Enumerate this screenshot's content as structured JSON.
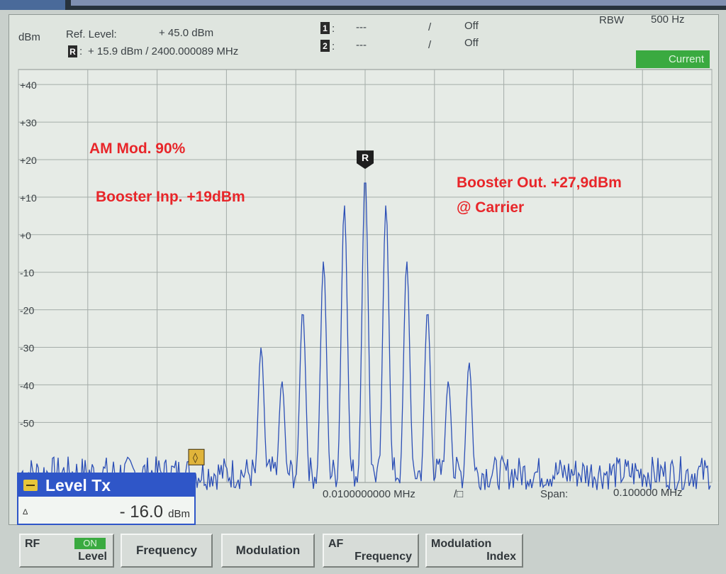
{
  "header": {
    "unit": "dBm",
    "ref_level_label": "Ref. Level:",
    "ref_level_value": "+ 45.0  dBm",
    "ref_marker_value": "+ 15.9  dBm /  2400.000089  MHz",
    "marker1_icon": "marker-1-icon",
    "marker1_value": "---",
    "marker1_sep": "/",
    "marker1_state": "Off",
    "marker2_icon": "marker-2-icon",
    "marker2_value": "---",
    "marker2_sep": "/",
    "marker2_state": "Off",
    "rbw_label": "RBW",
    "rbw_value": "500 Hz",
    "current_badge": "Current"
  },
  "footer": {
    "center_freq": "0.0100000000 MHz",
    "center_suffix": "/□",
    "span_label": "Span:",
    "span_value": "0.100000  MHz"
  },
  "annotations": {
    "am_mod": "AM Mod. 90%",
    "booster_inp": "Booster Inp. +19dBm",
    "booster_out_line1": "Booster Out. +27,9dBm",
    "booster_out_line2": "@ Carrier"
  },
  "level_box": {
    "title": "Level Tx",
    "delta": "Δ",
    "entry": "- 16.0",
    "unit": "dBm"
  },
  "softkeys": [
    {
      "name": "softkey-rf-level",
      "top_left": "RF",
      "badge": "ON",
      "bottom_right": "Level"
    },
    {
      "name": "softkey-frequency",
      "center": "Frequency"
    },
    {
      "name": "softkey-modulation",
      "center": "Modulation"
    },
    {
      "name": "softkey-af-frequency",
      "top_left": "AF",
      "bottom_right": "Frequency"
    },
    {
      "name": "softkey-modulation-index",
      "top_left": "Modulation",
      "bottom_right": "Index"
    }
  ],
  "chart_data": {
    "type": "line",
    "ylabel": "dBm",
    "y_ticks": [
      "+40",
      "+30",
      "+20",
      "+10",
      "+0",
      "-10",
      "-20",
      "-30",
      "-40",
      "-50"
    ],
    "ylim": [
      -66,
      44
    ],
    "x_divisions": 10,
    "grid": true,
    "trace_color": "#2c4fb6",
    "peaks": [
      {
        "offset_div": -1.5,
        "level_dbm": -30
      },
      {
        "offset_div": -1.2,
        "level_dbm": -39
      },
      {
        "offset_div": -0.9,
        "level_dbm": -20
      },
      {
        "offset_div": -0.6,
        "level_dbm": -7
      },
      {
        "offset_div": -0.3,
        "level_dbm": 8
      },
      {
        "offset_div": 0.0,
        "level_dbm": 16
      },
      {
        "offset_div": 0.3,
        "level_dbm": 8
      },
      {
        "offset_div": 0.6,
        "level_dbm": -7
      },
      {
        "offset_div": 0.9,
        "level_dbm": -20
      },
      {
        "offset_div": 1.2,
        "level_dbm": -39
      },
      {
        "offset_div": 1.5,
        "level_dbm": -34
      }
    ],
    "noise_floor_dbm": -60,
    "ref_marker_label": "R",
    "ref_marker_level_dbm": 16,
    "level_marker_label": "◊",
    "level_marker_level_dbm": -60
  }
}
